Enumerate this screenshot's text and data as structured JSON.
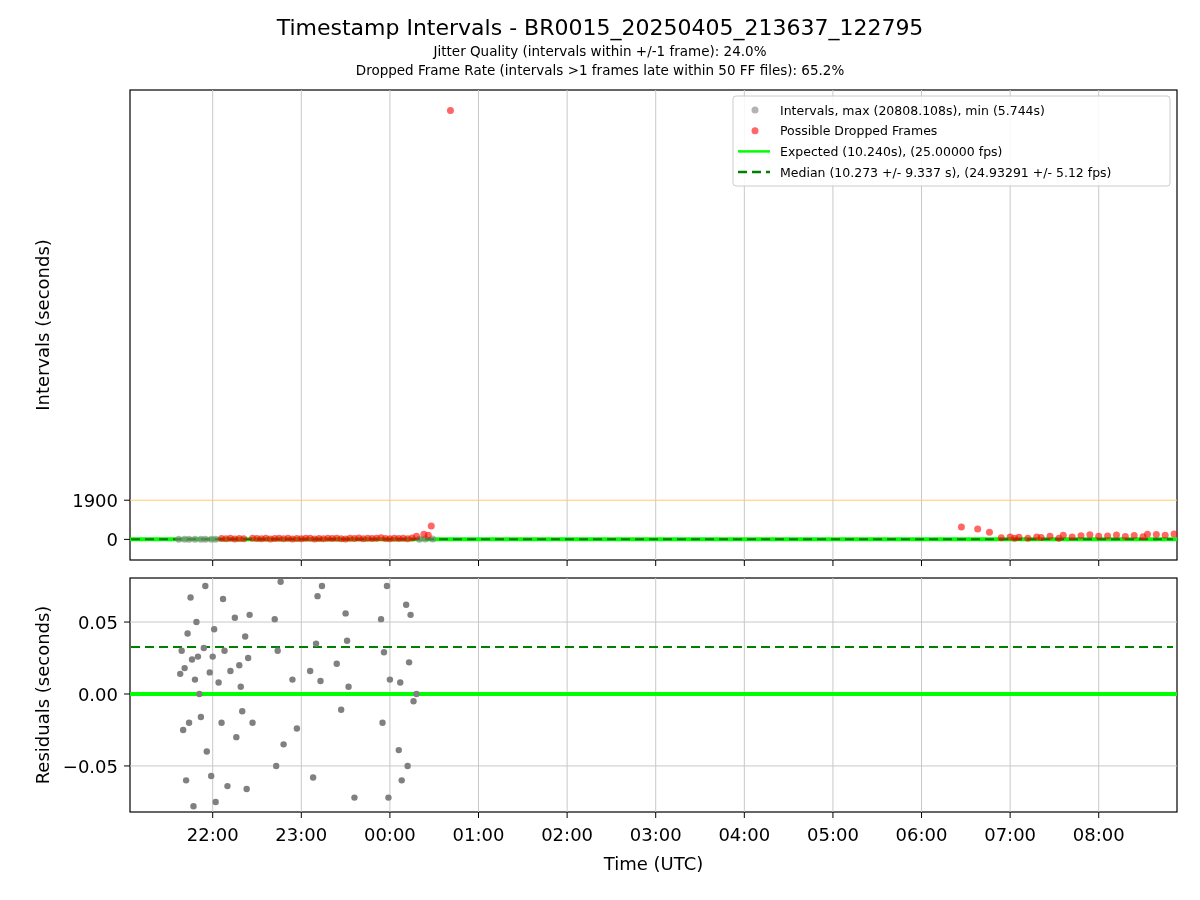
{
  "figure": {
    "title": "Timestamp Intervals - BR0015_20250405_213637_122795",
    "subtitles": [
      "Jitter Quality (intervals within +/-1 frame): 24.0%",
      "Dropped Frame Rate (intervals >1 frames late within 50 FF files): 65.2%"
    ]
  },
  "plots": [
    {
      "chart_data": {
        "type": "scatter",
        "ylabel": "Intervals (seconds)",
        "grid": "x",
        "xlim": [
          "2025-04-05T21:04",
          "2025-04-06T08:53"
        ],
        "ylim": [
          -1000,
          21800
        ],
        "yticks": [
          {
            "value": 0,
            "label": "0"
          },
          {
            "value": 1900,
            "label": "1900"
          }
        ],
        "series": [
          {
            "name": "Intervals, max (20808.108s), min (5.744s)",
            "color": "#808080",
            "x": [
              "2025-04-05T21:37",
              "2025-04-05T21:41",
              "2025-04-05T21:44",
              "2025-04-05T21:48",
              "2025-04-05T21:52",
              "2025-04-05T21:55",
              "2025-04-05T21:59",
              "2025-04-05T22:02",
              "2025-04-06T00:20",
              "2025-04-06T00:24",
              "2025-04-06T00:29"
            ],
            "values": [
              10,
              10,
              10,
              10,
              10,
              10,
              10,
              10,
              10,
              20,
              20
            ]
          },
          {
            "name": "Possible Dropped Frames",
            "color": "#ff0000",
            "x": [
              "2025-04-05T22:06",
              "2025-04-05T22:09",
              "2025-04-05T22:12",
              "2025-04-05T22:15",
              "2025-04-05T22:18",
              "2025-04-05T22:21",
              "2025-04-05T22:27",
              "2025-04-05T22:30",
              "2025-04-05T22:33",
              "2025-04-05T22:36",
              "2025-04-05T22:39",
              "2025-04-05T22:42",
              "2025-04-05T22:45",
              "2025-04-05T22:48",
              "2025-04-05T22:51",
              "2025-04-05T22:54",
              "2025-04-05T22:57",
              "2025-04-05T23:00",
              "2025-04-05T23:03",
              "2025-04-05T23:06",
              "2025-04-05T23:09",
              "2025-04-05T23:12",
              "2025-04-05T23:15",
              "2025-04-05T23:18",
              "2025-04-05T23:21",
              "2025-04-05T23:24",
              "2025-04-05T23:27",
              "2025-04-05T23:30",
              "2025-04-05T23:33",
              "2025-04-05T23:36",
              "2025-04-05T23:39",
              "2025-04-05T23:42",
              "2025-04-05T23:45",
              "2025-04-05T23:48",
              "2025-04-05T23:51",
              "2025-04-05T23:54",
              "2025-04-05T23:57",
              "2025-04-06T00:00",
              "2025-04-06T00:03",
              "2025-04-06T00:06",
              "2025-04-06T00:09",
              "2025-04-06T00:12",
              "2025-04-06T00:15",
              "2025-04-06T00:18",
              "2025-04-06T00:23",
              "2025-04-06T00:26",
              "2025-04-06T00:28",
              "2025-04-06T00:41",
              "2025-04-06T06:27",
              "2025-04-06T06:38",
              "2025-04-06T06:46",
              "2025-04-06T06:54",
              "2025-04-06T07:00",
              "2025-04-06T07:03",
              "2025-04-06T07:06",
              "2025-04-06T07:12",
              "2025-04-06T07:18",
              "2025-04-06T07:21",
              "2025-04-06T07:27",
              "2025-04-06T07:33",
              "2025-04-06T07:36",
              "2025-04-06T07:42",
              "2025-04-06T07:48",
              "2025-04-06T07:54",
              "2025-04-06T08:00",
              "2025-04-06T08:06",
              "2025-04-06T08:12",
              "2025-04-06T08:18",
              "2025-04-06T08:24",
              "2025-04-06T08:30",
              "2025-04-06T08:33",
              "2025-04-06T08:39",
              "2025-04-06T08:45",
              "2025-04-06T08:51"
            ],
            "values": [
              40,
              30,
              50,
              20,
              40,
              30,
              60,
              40,
              30,
              50,
              20,
              40,
              60,
              30,
              50,
              20,
              40,
              30,
              50,
              60,
              20,
              40,
              30,
              50,
              40,
              60,
              30,
              20,
              50,
              40,
              70,
              30,
              60,
              40,
              50,
              80,
              40,
              30,
              60,
              40,
              50,
              30,
              70,
              150,
              250,
              200,
              650,
              20800,
              600,
              500,
              350,
              80,
              120,
              60,
              100,
              50,
              120,
              90,
              150,
              60,
              200,
              110,
              180,
              220,
              150,
              170,
              210,
              140,
              190,
              130,
              250,
              240,
              200,
              260
            ]
          }
        ],
        "ref_lines": [
          {
            "axis": "y",
            "value": 10.24,
            "color": "#00ff00",
            "label": "Expected (10.240s), (25.00000 fps)"
          },
          {
            "axis": "y",
            "value": 10.273,
            "color": "#008000",
            "label": "Median (10.273 +/- 9.337 s), (24.93291 +/- 5.12 fps)"
          },
          {
            "axis": "y",
            "value": 1900,
            "color": "#ffcc66"
          }
        ],
        "legend": true
      }
    },
    {
      "chart_data": {
        "type": "scatter",
        "ylabel": "Residuals (seconds)",
        "xlabel": "Time (UTC)",
        "grid": "both",
        "xlim": [
          "2025-04-05T21:04",
          "2025-04-06T08:53"
        ],
        "ylim": [
          -0.082,
          0.0806
        ],
        "xticks": [
          {
            "value": "2025-04-05T22:00",
            "label": "22:00"
          },
          {
            "value": "2025-04-05T23:00",
            "label": "23:00"
          },
          {
            "value": "2025-04-06T00:00",
            "label": "00:00"
          },
          {
            "value": "2025-04-06T01:00",
            "label": "01:00"
          },
          {
            "value": "2025-04-06T02:00",
            "label": "02:00"
          },
          {
            "value": "2025-04-06T03:00",
            "label": "03:00"
          },
          {
            "value": "2025-04-06T04:00",
            "label": "04:00"
          },
          {
            "value": "2025-04-06T05:00",
            "label": "05:00"
          },
          {
            "value": "2025-04-06T06:00",
            "label": "06:00"
          },
          {
            "value": "2025-04-06T07:00",
            "label": "07:00"
          },
          {
            "value": "2025-04-06T08:00",
            "label": "08:00"
          }
        ],
        "yticks": [
          {
            "value": -0.05,
            "label": "−0.05"
          },
          {
            "value": 0,
            "label": "0.00"
          },
          {
            "value": 0.05,
            "label": "0.05"
          }
        ],
        "series": [
          {
            "color": "#808080",
            "x": [
              "2025-04-05T21:38",
              "2025-04-05T21:39",
              "2025-04-05T21:40",
              "2025-04-05T21:41",
              "2025-04-05T21:42",
              "2025-04-05T21:43",
              "2025-04-05T21:44",
              "2025-04-05T21:45",
              "2025-04-05T21:46",
              "2025-04-05T21:47",
              "2025-04-05T21:48",
              "2025-04-05T21:49",
              "2025-04-05T21:50",
              "2025-04-05T21:51",
              "2025-04-05T21:52",
              "2025-04-05T21:54",
              "2025-04-05T21:55",
              "2025-04-05T21:56",
              "2025-04-05T21:58",
              "2025-04-05T21:59",
              "2025-04-05T22:00",
              "2025-04-05T22:01",
              "2025-04-05T22:02",
              "2025-04-05T22:04",
              "2025-04-05T22:06",
              "2025-04-05T22:07",
              "2025-04-05T22:08",
              "2025-04-05T22:10",
              "2025-04-05T22:12",
              "2025-04-05T22:15",
              "2025-04-05T22:16",
              "2025-04-05T22:18",
              "2025-04-05T22:19",
              "2025-04-05T22:20",
              "2025-04-05T22:22",
              "2025-04-05T22:23",
              "2025-04-05T22:24",
              "2025-04-05T22:25",
              "2025-04-05T22:27",
              "2025-04-05T22:42",
              "2025-04-05T22:43",
              "2025-04-05T22:44",
              "2025-04-05T22:46",
              "2025-04-05T22:48",
              "2025-04-05T22:54",
              "2025-04-05T22:57",
              "2025-04-05T23:06",
              "2025-04-05T23:08",
              "2025-04-05T23:10",
              "2025-04-05T23:11",
              "2025-04-05T23:13",
              "2025-04-05T23:14",
              "2025-04-05T23:24",
              "2025-04-05T23:27",
              "2025-04-05T23:30",
              "2025-04-05T23:31",
              "2025-04-05T23:32",
              "2025-04-05T23:36",
              "2025-04-05T23:54",
              "2025-04-05T23:55",
              "2025-04-05T23:56",
              "2025-04-05T23:58",
              "2025-04-05T23:59",
              "2025-04-06T00:00",
              "2025-04-06T00:06",
              "2025-04-06T00:07",
              "2025-04-06T00:08",
              "2025-04-06T00:11",
              "2025-04-06T00:12",
              "2025-04-06T00:13",
              "2025-04-06T00:14",
              "2025-04-06T00:16",
              "2025-04-06T00:18"
            ],
            "values": [
              0.014,
              0.03,
              -0.025,
              0.018,
              -0.06,
              0.042,
              -0.02,
              0.067,
              0.024,
              -0.078,
              0.01,
              0.05,
              0.026,
              0.0,
              -0.016,
              0.032,
              0.075,
              -0.04,
              0.015,
              -0.057,
              0.026,
              0.045,
              -0.075,
              0.008,
              -0.02,
              0.066,
              0.03,
              -0.064,
              0.016,
              0.053,
              -0.03,
              0.02,
              0.005,
              -0.012,
              0.04,
              -0.066,
              0.025,
              0.055,
              -0.02,
              0.052,
              -0.05,
              0.03,
              0.078,
              -0.035,
              0.01,
              -0.024,
              0.016,
              -0.058,
              0.035,
              0.068,
              0.009,
              0.075,
              0.021,
              -0.011,
              0.056,
              0.037,
              0.005,
              -0.072,
              0.052,
              -0.02,
              0.029,
              0.075,
              -0.072,
              0.01,
              -0.039,
              0.008,
              -0.06,
              0.062,
              -0.05,
              0.022,
              0.055,
              -0.005,
              0.0
            ]
          }
        ],
        "ref_lines": [
          {
            "axis": "y",
            "value": 0,
            "color": "#00ff00"
          },
          {
            "axis": "y",
            "value": 0.0326,
            "color": "#008000"
          }
        ]
      }
    }
  ]
}
